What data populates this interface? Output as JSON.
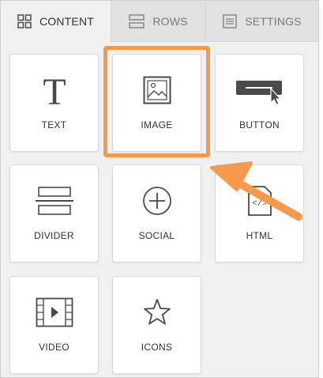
{
  "tabs": [
    {
      "label": "CONTENT",
      "icon": "grid-icon",
      "active": true
    },
    {
      "label": "ROWS",
      "icon": "rows-icon",
      "active": false
    },
    {
      "label": "SETTINGS",
      "icon": "settings-icon",
      "active": false
    }
  ],
  "blocks": [
    {
      "label": "TEXT",
      "icon": "text-icon"
    },
    {
      "label": "IMAGE",
      "icon": "image-icon",
      "highlighted": true
    },
    {
      "label": "BUTTON",
      "icon": "button-icon"
    },
    {
      "label": "DIVIDER",
      "icon": "divider-icon"
    },
    {
      "label": "SOCIAL",
      "icon": "social-plus-icon"
    },
    {
      "label": "HTML",
      "icon": "html-code-icon"
    },
    {
      "label": "VIDEO",
      "icon": "video-icon"
    },
    {
      "label": "ICONS",
      "icon": "star-icon"
    }
  ],
  "colors": {
    "highlight": "#f59a4c",
    "icon_dark": "#4a4a4a",
    "panel_bg": "#f0f0f0",
    "tab_inactive_bg": "#e1e1e1"
  }
}
